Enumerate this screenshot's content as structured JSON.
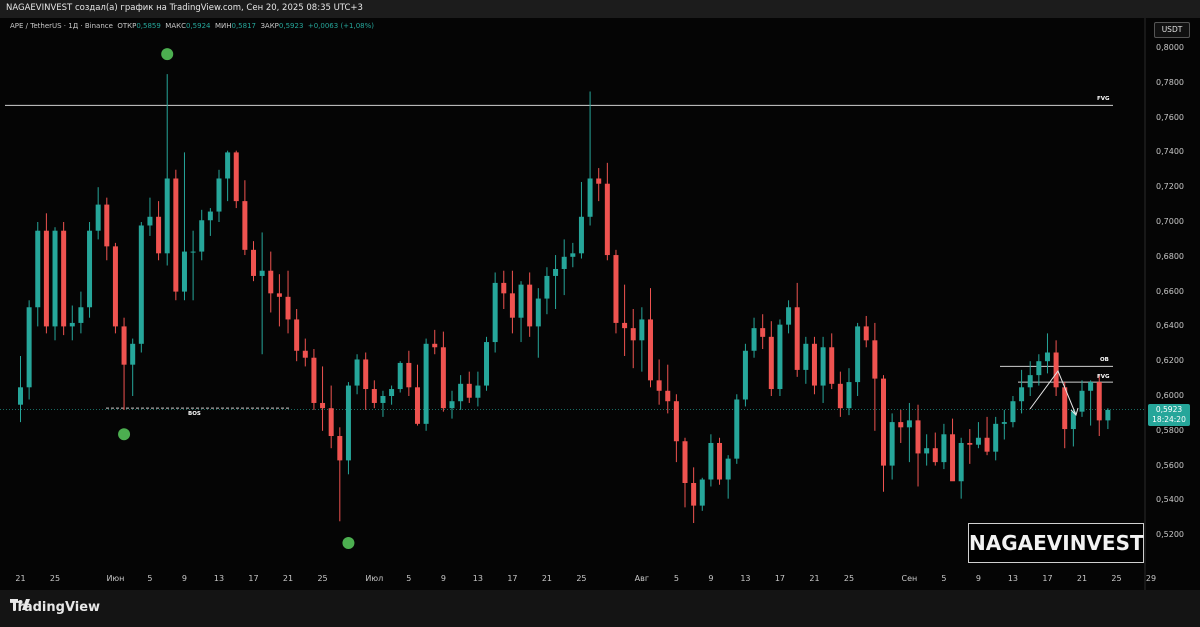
{
  "header": {
    "attribution": "NAGAEVINVEST создал(а) график на TradingView.com, Сен 20, 2025 08:35 UTC+3"
  },
  "legend": {
    "symbol": "APE / TetherUS · 1Д · Binance",
    "open_label": "ОТКР",
    "open_value": "0,5859",
    "high_label": "МАКС",
    "high_value": "0,5924",
    "low_label": "МИН",
    "low_value": "0,5817",
    "close_label": "ЗАКР",
    "close_value": "0,5923",
    "change": "+0,0063 (+1,08%)"
  },
  "currency_button": "USDT",
  "price_badge": {
    "price": "0,5923",
    "countdown": "18:24:20"
  },
  "watermark": "NAGAEVINVEST",
  "footer": {
    "brand": "TradingView"
  },
  "colors": {
    "up": "#26a69a",
    "down": "#ef5350",
    "marker": "#4caf50",
    "background": "#050505"
  },
  "chart_data": {
    "type": "candlestick",
    "title": "APE / TetherUS · 1Д · Binance",
    "ylim": [
      0.5,
      0.81
    ],
    "y_ticks": [
      "0,8000",
      "0,7800",
      "0,7600",
      "0,7400",
      "0,7200",
      "0,7000",
      "0,6800",
      "0,6600",
      "0,6400",
      "0,6200",
      "0,6000",
      "0,5800",
      "0,5600",
      "0,5400",
      "0,5200"
    ],
    "y_tick_values": [
      0.8,
      0.78,
      0.76,
      0.74,
      0.72,
      0.7,
      0.68,
      0.66,
      0.64,
      0.62,
      0.6,
      0.58,
      0.56,
      0.54,
      0.52
    ],
    "x_ticks": [
      "21",
      "25",
      "Июн",
      "5",
      "9",
      "13",
      "17",
      "21",
      "25",
      "Июл",
      "5",
      "9",
      "13",
      "17",
      "21",
      "25",
      "Авг",
      "5",
      "9",
      "13",
      "17",
      "21",
      "25",
      "Сен",
      "5",
      "9",
      "13",
      "17",
      "21",
      "25",
      "29"
    ],
    "x_tick_days": [
      0,
      4,
      11,
      15,
      19,
      23,
      27,
      31,
      35,
      41,
      45,
      49,
      53,
      57,
      61,
      65,
      72,
      76,
      80,
      84,
      88,
      92,
      96,
      103,
      107,
      111,
      115,
      119,
      123,
      127,
      131
    ],
    "start_date": "2025-05-21",
    "candles": [
      [
        0.595,
        0.623,
        0.585,
        0.605
      ],
      [
        0.605,
        0.655,
        0.598,
        0.651
      ],
      [
        0.651,
        0.7,
        0.64,
        0.695
      ],
      [
        0.695,
        0.705,
        0.636,
        0.64
      ],
      [
        0.64,
        0.697,
        0.632,
        0.695
      ],
      [
        0.695,
        0.7,
        0.635,
        0.64
      ],
      [
        0.64,
        0.652,
        0.632,
        0.642
      ],
      [
        0.642,
        0.66,
        0.636,
        0.651
      ],
      [
        0.651,
        0.7,
        0.645,
        0.695
      ],
      [
        0.695,
        0.72,
        0.69,
        0.71
      ],
      [
        0.71,
        0.714,
        0.678,
        0.686
      ],
      [
        0.686,
        0.688,
        0.636,
        0.64
      ],
      [
        0.64,
        0.645,
        0.592,
        0.618
      ],
      [
        0.618,
        0.633,
        0.6,
        0.63
      ],
      [
        0.63,
        0.7,
        0.625,
        0.698
      ],
      [
        0.698,
        0.714,
        0.692,
        0.703
      ],
      [
        0.703,
        0.712,
        0.678,
        0.682
      ],
      [
        0.682,
        0.785,
        0.675,
        0.725
      ],
      [
        0.725,
        0.73,
        0.655,
        0.66
      ],
      [
        0.66,
        0.74,
        0.655,
        0.683
      ],
      [
        0.683,
        0.695,
        0.655,
        0.683
      ],
      [
        0.683,
        0.707,
        0.678,
        0.701
      ],
      [
        0.701,
        0.708,
        0.692,
        0.706
      ],
      [
        0.706,
        0.73,
        0.7,
        0.725
      ],
      [
        0.725,
        0.741,
        0.712,
        0.74
      ],
      [
        0.74,
        0.741,
        0.708,
        0.712
      ],
      [
        0.712,
        0.724,
        0.681,
        0.684
      ],
      [
        0.684,
        0.689,
        0.666,
        0.669
      ],
      [
        0.669,
        0.694,
        0.624,
        0.672
      ],
      [
        0.672,
        0.683,
        0.648,
        0.659
      ],
      [
        0.659,
        0.67,
        0.64,
        0.657
      ],
      [
        0.657,
        0.672,
        0.636,
        0.644
      ],
      [
        0.644,
        0.65,
        0.62,
        0.626
      ],
      [
        0.626,
        0.633,
        0.617,
        0.622
      ],
      [
        0.622,
        0.627,
        0.592,
        0.596
      ],
      [
        0.596,
        0.617,
        0.58,
        0.593
      ],
      [
        0.593,
        0.606,
        0.57,
        0.577
      ],
      [
        0.577,
        0.582,
        0.528,
        0.563
      ],
      [
        0.563,
        0.608,
        0.555,
        0.606
      ],
      [
        0.606,
        0.624,
        0.601,
        0.621
      ],
      [
        0.621,
        0.625,
        0.592,
        0.604
      ],
      [
        0.604,
        0.609,
        0.593,
        0.596
      ],
      [
        0.596,
        0.603,
        0.588,
        0.6
      ],
      [
        0.6,
        0.606,
        0.595,
        0.604
      ],
      [
        0.604,
        0.62,
        0.602,
        0.619
      ],
      [
        0.619,
        0.626,
        0.6,
        0.605
      ],
      [
        0.605,
        0.618,
        0.583,
        0.584
      ],
      [
        0.584,
        0.633,
        0.58,
        0.63
      ],
      [
        0.63,
        0.638,
        0.624,
        0.628
      ],
      [
        0.628,
        0.637,
        0.591,
        0.593
      ],
      [
        0.593,
        0.603,
        0.587,
        0.597
      ],
      [
        0.597,
        0.612,
        0.592,
        0.607
      ],
      [
        0.607,
        0.614,
        0.596,
        0.599
      ],
      [
        0.599,
        0.614,
        0.594,
        0.606
      ],
      [
        0.606,
        0.634,
        0.603,
        0.631
      ],
      [
        0.631,
        0.671,
        0.625,
        0.665
      ],
      [
        0.665,
        0.672,
        0.65,
        0.659
      ],
      [
        0.659,
        0.672,
        0.636,
        0.645
      ],
      [
        0.645,
        0.666,
        0.631,
        0.664
      ],
      [
        0.664,
        0.671,
        0.634,
        0.64
      ],
      [
        0.64,
        0.662,
        0.622,
        0.656
      ],
      [
        0.656,
        0.674,
        0.647,
        0.669
      ],
      [
        0.669,
        0.681,
        0.65,
        0.673
      ],
      [
        0.673,
        0.69,
        0.658,
        0.68
      ],
      [
        0.68,
        0.688,
        0.674,
        0.682
      ],
      [
        0.682,
        0.723,
        0.679,
        0.703
      ],
      [
        0.703,
        0.775,
        0.698,
        0.725
      ],
      [
        0.725,
        0.731,
        0.712,
        0.722
      ],
      [
        0.722,
        0.734,
        0.678,
        0.681
      ],
      [
        0.681,
        0.684,
        0.636,
        0.642
      ],
      [
        0.642,
        0.664,
        0.623,
        0.639
      ],
      [
        0.639,
        0.65,
        0.616,
        0.632
      ],
      [
        0.632,
        0.651,
        0.614,
        0.644
      ],
      [
        0.644,
        0.662,
        0.605,
        0.609
      ],
      [
        0.609,
        0.621,
        0.595,
        0.603
      ],
      [
        0.603,
        0.618,
        0.59,
        0.597
      ],
      [
        0.597,
        0.601,
        0.562,
        0.574
      ],
      [
        0.574,
        0.576,
        0.536,
        0.55
      ],
      [
        0.55,
        0.559,
        0.527,
        0.537
      ],
      [
        0.537,
        0.553,
        0.534,
        0.552
      ],
      [
        0.552,
        0.578,
        0.548,
        0.573
      ],
      [
        0.573,
        0.576,
        0.549,
        0.552
      ],
      [
        0.552,
        0.566,
        0.541,
        0.564
      ],
      [
        0.564,
        0.601,
        0.561,
        0.598
      ],
      [
        0.598,
        0.63,
        0.594,
        0.626
      ],
      [
        0.626,
        0.645,
        0.622,
        0.639
      ],
      [
        0.639,
        0.647,
        0.627,
        0.634
      ],
      [
        0.634,
        0.643,
        0.6,
        0.604
      ],
      [
        0.604,
        0.644,
        0.6,
        0.641
      ],
      [
        0.641,
        0.655,
        0.636,
        0.651
      ],
      [
        0.651,
        0.665,
        0.611,
        0.615
      ],
      [
        0.615,
        0.634,
        0.607,
        0.63
      ],
      [
        0.63,
        0.634,
        0.601,
        0.606
      ],
      [
        0.606,
        0.634,
        0.596,
        0.628
      ],
      [
        0.628,
        0.636,
        0.604,
        0.607
      ],
      [
        0.607,
        0.614,
        0.588,
        0.593
      ],
      [
        0.593,
        0.616,
        0.589,
        0.608
      ],
      [
        0.608,
        0.642,
        0.6,
        0.64
      ],
      [
        0.64,
        0.646,
        0.628,
        0.632
      ],
      [
        0.632,
        0.642,
        0.58,
        0.61
      ],
      [
        0.61,
        0.612,
        0.545,
        0.56
      ],
      [
        0.56,
        0.59,
        0.552,
        0.585
      ],
      [
        0.585,
        0.592,
        0.573,
        0.582
      ],
      [
        0.582,
        0.596,
        0.562,
        0.586
      ],
      [
        0.586,
        0.595,
        0.548,
        0.567
      ],
      [
        0.567,
        0.578,
        0.56,
        0.57
      ],
      [
        0.57,
        0.579,
        0.56,
        0.562
      ],
      [
        0.562,
        0.584,
        0.558,
        0.578
      ],
      [
        0.578,
        0.587,
        0.56,
        0.551
      ],
      [
        0.551,
        0.576,
        0.541,
        0.573
      ],
      [
        0.573,
        0.581,
        0.561,
        0.572
      ],
      [
        0.572,
        0.585,
        0.57,
        0.576
      ],
      [
        0.576,
        0.588,
        0.566,
        0.568
      ],
      [
        0.568,
        0.588,
        0.563,
        0.584
      ],
      [
        0.584,
        0.592,
        0.575,
        0.585
      ],
      [
        0.585,
        0.6,
        0.582,
        0.597
      ],
      [
        0.597,
        0.615,
        0.59,
        0.605
      ],
      [
        0.605,
        0.62,
        0.6,
        0.612
      ],
      [
        0.612,
        0.624,
        0.606,
        0.62
      ],
      [
        0.62,
        0.636,
        0.613,
        0.625
      ],
      [
        0.625,
        0.632,
        0.6,
        0.605
      ],
      [
        0.605,
        0.608,
        0.57,
        0.581
      ],
      [
        0.581,
        0.592,
        0.571,
        0.591
      ],
      [
        0.591,
        0.609,
        0.588,
        0.603
      ],
      [
        0.603,
        0.609,
        0.583,
        0.608
      ],
      [
        0.608,
        0.612,
        0.577,
        0.586
      ],
      [
        0.586,
        0.593,
        0.581,
        0.592
      ]
    ],
    "levels": [
      {
        "label": "FVG",
        "price": 0.767
      },
      {
        "label": "BOS",
        "price": 0.593
      },
      {
        "label": "OB",
        "price": 0.617
      },
      {
        "label": "FVG",
        "price": 0.608
      }
    ],
    "current_price": 0.5923,
    "markers": [
      {
        "day": 17,
        "price": 0.7965
      },
      {
        "day": 12,
        "price": 0.578
      },
      {
        "day": 38,
        "price": 0.5155
      }
    ]
  }
}
